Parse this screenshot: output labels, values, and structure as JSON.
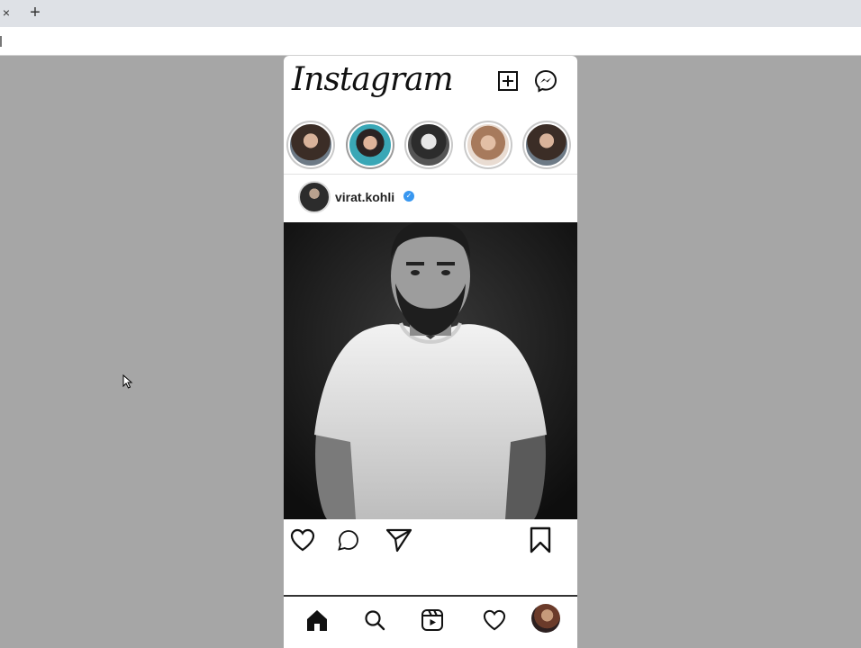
{
  "browser": {
    "tab_close": "×",
    "new_tab": "+"
  },
  "app": {
    "logo": "Instagram",
    "header_icons": [
      "new-post-icon",
      "messenger-icon"
    ],
    "stories": [
      {
        "name": "story-1",
        "color": "#7b6a5e"
      },
      {
        "name": "story-2",
        "color": "#3aa7b6"
      },
      {
        "name": "story-3",
        "color": "#d8d8d8"
      },
      {
        "name": "story-4",
        "color": "#c49a7c"
      },
      {
        "name": "story-5",
        "color": "#7b6a5e"
      }
    ],
    "post": {
      "username": "virat.kohli",
      "verified": "✓"
    },
    "actions": [
      "like-icon",
      "comment-icon",
      "share-icon",
      "bookmark-icon"
    ],
    "bottom_nav": [
      "home-icon",
      "search-icon",
      "reels-icon",
      "activity-icon",
      "profile-avatar"
    ]
  }
}
